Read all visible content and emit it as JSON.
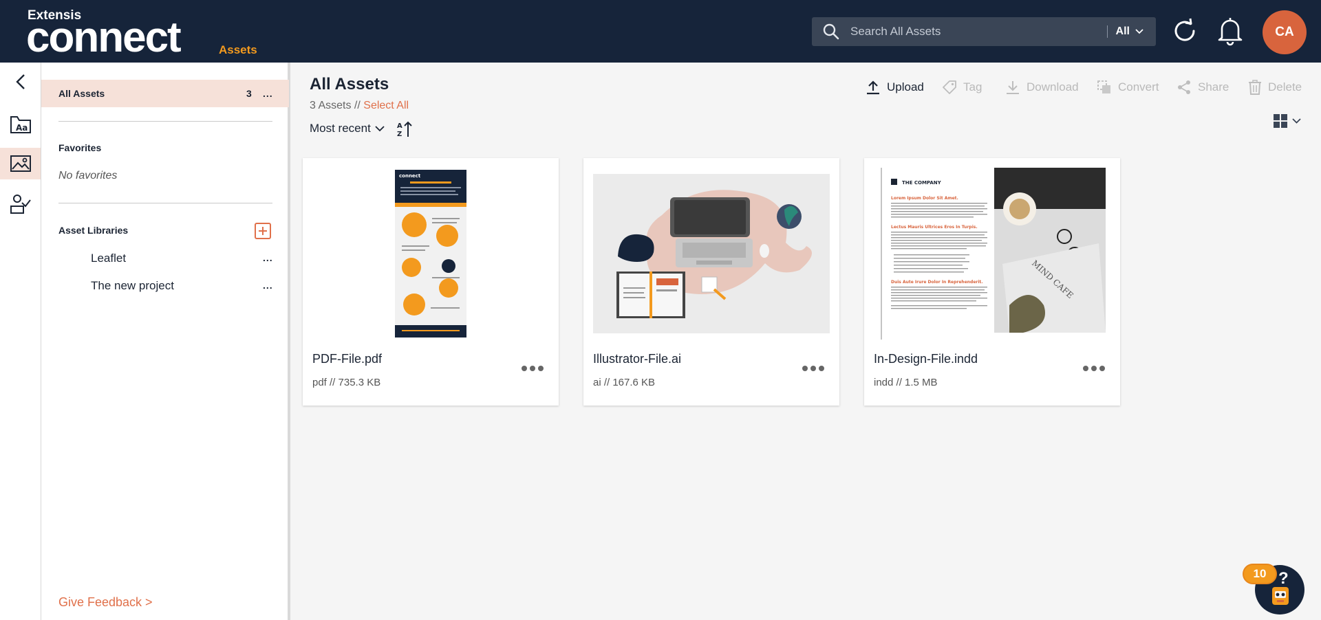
{
  "brand": {
    "company": "Extensis",
    "product": "connect",
    "section": "Assets"
  },
  "search": {
    "placeholder": "Search All Assets",
    "scope": "All"
  },
  "user": {
    "initials": "CA"
  },
  "sidebar": {
    "all_assets_label": "All Assets",
    "all_assets_count": "3",
    "more": "...",
    "favorites_title": "Favorites",
    "no_favorites": "No favorites",
    "libraries_title": "Asset Libraries",
    "libraries": [
      {
        "name": "Leaflet",
        "more": "..."
      },
      {
        "name": "The new project",
        "more": "..."
      }
    ],
    "feedback": "Give Feedback >"
  },
  "main": {
    "title": "All Assets",
    "asset_count": "3 Assets //",
    "select_all": "Select All",
    "sort_label": "Most recent"
  },
  "toolbar": {
    "upload": "Upload",
    "tag": "Tag",
    "download": "Download",
    "convert": "Convert",
    "share": "Share",
    "delete": "Delete"
  },
  "assets": [
    {
      "name": "PDF-File.pdf",
      "meta": "pdf // 735.3 KB"
    },
    {
      "name": "Illustrator-File.ai",
      "meta": "ai // 167.6 KB"
    },
    {
      "name": "In-Design-File.indd",
      "meta": "indd // 1.5 MB"
    }
  ],
  "thumbs": {
    "pdf_brand": "connect",
    "indd_company": "THE COMPANY",
    "indd_heading1": "Lorem Ipsum Dolor Sit Amet.",
    "indd_heading2": "Lectus Mauris Ultrices Eros In Turpis.",
    "indd_heading3": "Duis Aute Irure Dolor In Reprehenderit.",
    "indd_magazine": "MIND CAFE"
  },
  "help": {
    "badge": "10",
    "glyph": "?"
  },
  "colors": {
    "header": "#16243a",
    "accent": "#e0704a",
    "brand_orange": "#f39a1e",
    "active_bg": "#f6e1d9"
  }
}
